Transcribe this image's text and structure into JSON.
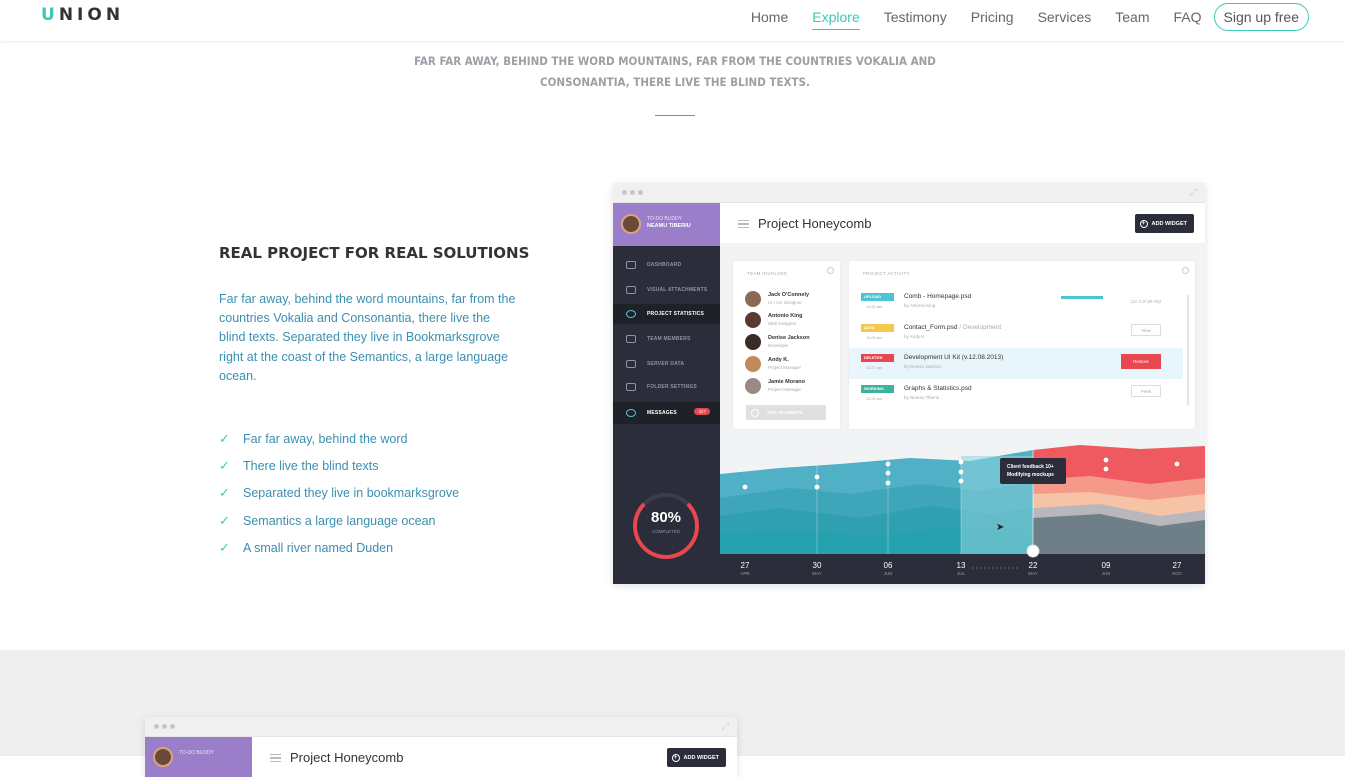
{
  "nav": {
    "logo_first": "U",
    "logo_rest": "NION",
    "links": [
      "Home",
      "Explore",
      "Testimony",
      "Pricing",
      "Services",
      "Team",
      "FAQ"
    ],
    "active": "Explore",
    "signup": "Sign up free"
  },
  "intro": {
    "text": "Far far away, behind the word mountains, far from the countries Vokalia and Consonantia, there live the blind texts."
  },
  "feature": {
    "title": "Real Project For Real Solutions",
    "description": "Far far away, behind the word mountains, far from the countries Vokalia and Consonantia, there live the blind texts. Separated they live in Bookmarksgrove right at the coast of the Semantics, a large language ocean.",
    "checks": [
      "Far far away, behind the word",
      "There live the blind texts",
      "Separated they live in bookmarksgrove",
      "Semantics a large language ocean",
      "A small river named Duden"
    ]
  },
  "mock": {
    "user_small": "TO-DO BUDDY",
    "user_name": "NEAMU TIBERIU",
    "sidebar": [
      {
        "label": "DASHBOARD"
      },
      {
        "label": "VISUAL ATTACHMENTS"
      },
      {
        "label": "PROJECT STATISTICS"
      },
      {
        "label": "TEAM MEMBERS"
      },
      {
        "label": "SERVER DATA"
      },
      {
        "label": "FOLDER SETTINGS"
      },
      {
        "label": "MESSAGES"
      }
    ],
    "messages_badge": "327",
    "progress_value": "80%",
    "progress_label": "COMPLETED",
    "progress_fraction": 0.8,
    "project_title": "Project Honeycomb",
    "add_widget": "ADD WIDGET",
    "team_title": "TEAM INVOLVED",
    "team": [
      {
        "name": "Jack O'Connely",
        "role": "UI / UX Designer",
        "color": "#8a6a55"
      },
      {
        "name": "Antonio King",
        "role": "Web Designer",
        "color": "#5a3a30"
      },
      {
        "name": "Denise Jackson",
        "role": "Developer",
        "color": "#3a2a28"
      },
      {
        "name": "Andy K.",
        "role": "Project Manager",
        "color": "#c08a5a"
      },
      {
        "name": "Jamie Morano",
        "role": "Project Manager",
        "color": "#9a8a85"
      }
    ],
    "add_teammate": "ADD TEAMMATE",
    "activity_title": "PROJECT ACTIVITY",
    "activity": [
      {
        "tag": "UPLOAD",
        "tag_color": "#4cc4d8",
        "time": "11:00 am",
        "file": "Comb - Homepage.psd",
        "extra": "",
        "by": "by Antonio King",
        "progress": 0.75,
        "count": "(12.3 of 38 mb)",
        "button": ""
      },
      {
        "tag": "DATA",
        "tag_color": "#f2c94c",
        "time": "11:09 am",
        "file": "Contact_Form.psd",
        "extra": " / Development",
        "by": "by Andy K.",
        "progress": null,
        "count": "",
        "button": "View"
      },
      {
        "tag": "DELETED",
        "tag_color": "#e8474f",
        "time": "11:27 am",
        "file": "Development UI Kit (v.12.08.2013)",
        "extra": "",
        "by": "by Denise Jackson",
        "progress": null,
        "count": "",
        "button": "Restore"
      },
      {
        "tag": "WORKING",
        "tag_color": "#3bb3a0",
        "time": "11:28 am",
        "file": "Graphs & Statistics.psd",
        "extra": "",
        "by": "by Neamu Tiberiu",
        "progress": null,
        "count": "",
        "button": "Peek"
      }
    ],
    "tooltip_line1": "Client feedback 10+",
    "tooltip_line2": "Modifying mockups",
    "chart_dates": [
      {
        "day": "27",
        "month": "APR"
      },
      {
        "day": "30",
        "month": "MAY"
      },
      {
        "day": "06",
        "month": "JUN"
      },
      {
        "day": "13",
        "month": "JUL"
      },
      {
        "day": "22",
        "month": "MAY"
      },
      {
        "day": "09",
        "month": "JUN"
      },
      {
        "day": "27",
        "month": "NOV"
      }
    ],
    "colors": {
      "sidebar": "#2b2d3a",
      "header": "#9b7ec9",
      "teal": "#4cc4d8",
      "red": "#e8474f"
    }
  },
  "mock2": {
    "user_small": "TO-DO BUDDY",
    "project_title": "Project Honeycomb",
    "add_widget": "ADD WIDGET"
  }
}
